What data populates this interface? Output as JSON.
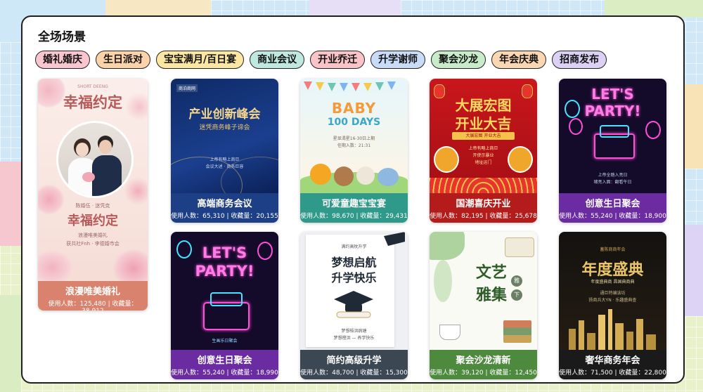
{
  "header": {
    "title": "全场场景"
  },
  "tags": [
    {
      "label": "婚礼婚庆",
      "color": "#f9c6cf"
    },
    {
      "label": "生日派对",
      "color": "#fcd3a8"
    },
    {
      "label": "宝宝满月/百日宴",
      "color": "#fbe7a1"
    },
    {
      "label": "商业会议",
      "color": "#bfe9df"
    },
    {
      "label": "开业乔迁",
      "color": "#f9c3c8"
    },
    {
      "label": "升学谢师",
      "color": "#c8dcf7"
    },
    {
      "label": "聚会沙龙",
      "color": "#c8ecc9"
    },
    {
      "label": "年会庆典",
      "color": "#fbd6b2"
    },
    {
      "label": "招商发布",
      "color": "#dcd0f5"
    }
  ],
  "cards": {
    "wedding": {
      "poster": {
        "top_small": "SHORT DEENG",
        "title": "幸福约定",
        "sub1": "陈婚伍 · 迷凭克",
        "title2": "幸福约定",
        "sub2": "浪漫唯美婚礼",
        "sub3": "获共社Fnh · 李德婚市会"
      },
      "name": "浪漫唯美婚礼",
      "stats": "使用人数：125,480 | 收藏量：38,912",
      "cap_color": "#d9826d"
    },
    "business": {
      "poster": {
        "logo": "商泊商网",
        "title": "产业创新峰会",
        "sub": "迷凭商务峰子谛会",
        "line1": "上帝有略上商巨",
        "line2": "会议大述 · 商务巨容"
      },
      "name": "高端商务会议",
      "stats": "使用人数：65,310 | 收藏量：20,155",
      "cap_color": "#1d3f86"
    },
    "baby": {
      "poster": {
        "t1": "BABY",
        "t2": "100 DAYS",
        "l1": "星显渴星16-30日上期",
        "l2": "任期入数：21:31"
      },
      "name": "可爱童趣宝宝宴",
      "stats": "使用人数：98,670 | 收藏量：29,431",
      "cap_color": "#2f9a8a"
    },
    "opening": {
      "poster": {
        "t1": "大展宏图",
        "t2": "开业大吉",
        "banner": "大展宏图 开业大吉",
        "l1": "上帝有略上商巨",
        "l2": "开使示暴业",
        "l3": "地址运门"
      },
      "name": "国潮喜庆开业",
      "stats": "使用人数：82,195 | 收藏量：25,678",
      "cap_color": "#b41c1c"
    },
    "party1": {
      "poster": {
        "t1": "LET'S",
        "t2": "PARTY!",
        "l1": "上帝全踏入亮日",
        "l2": "啸亮入面：翻看午日"
      },
      "name": "创意生日聚会",
      "stats": "使用人数：55,240 | 收藏量：18,900",
      "cap_color": "#6a2ca0"
    },
    "party2": {
      "poster": {
        "t1": "LET'S",
        "t2": "PARTY!",
        "l1": "生画乐日聚会"
      },
      "name": "创意生日聚会",
      "stats": "使用人数：55,240 | 收藏量：18,990",
      "cap_color": "#6a2ca0"
    },
    "graduation": {
      "poster": {
        "small": "满约高枕升学",
        "t1": "梦想启航",
        "t2": "升学快乐",
        "l1": "梦想梧洪病塘",
        "l2": "梦想橙洪 — 养学快乐"
      },
      "name": "简约高级升学",
      "stats": "使用人数：48,700 | 收藏量：15,300",
      "cap_color": "#3b4753"
    },
    "salon": {
      "poster": {
        "t1": "文艺",
        "t2": "雅集",
        "seal": "雅",
        "seal2": "下"
      },
      "name": "聚会沙龙清新",
      "stats": "使用人数：39,120 | 收藏量：12,450",
      "cap_color": "#4e8a3e"
    },
    "annual": {
      "poster": {
        "small": "蓄陈商商年会",
        "t1": "年度盛典",
        "sub": "年度盛典商 昌国典商典",
        "l1": "通巨特编该坊",
        "l2": "扬商兵大YN · 乐趣盛典查"
      },
      "name": "奢华商务年会",
      "stats": "使用人数：71,500 | 收藏量：22,800",
      "cap_color": "#1a1a1a"
    }
  },
  "colors": {
    "panel_border": "#1f1f1f",
    "gold": "#e9c46a",
    "neon_pink": "#ff4fd8",
    "neon_cyan": "#45e4ff"
  }
}
